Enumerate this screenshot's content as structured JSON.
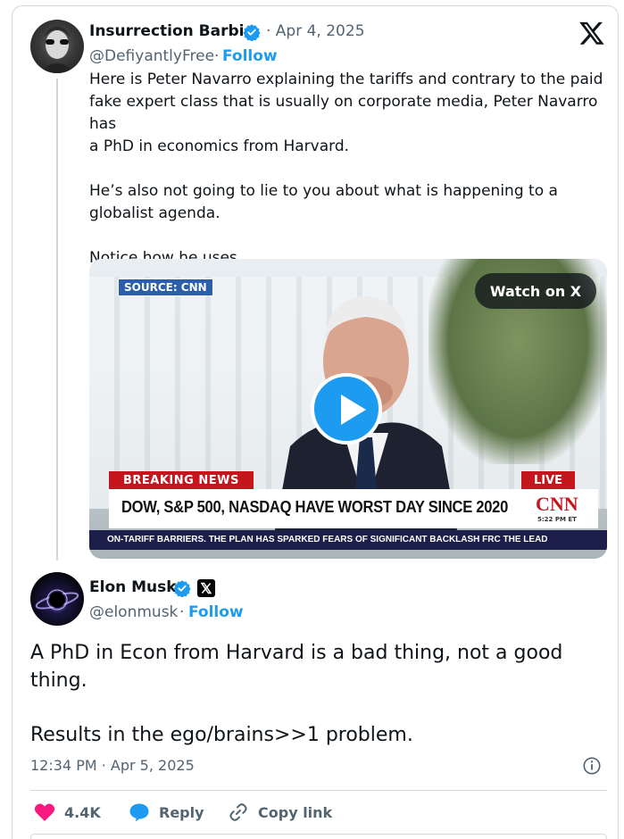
{
  "quoted": {
    "display_name": "Insurrection Barbie",
    "date": "· Apr 4, 2025",
    "handle": "@DefiyantlyFree",
    "separator": "·",
    "follow_label": "Follow",
    "text_lines": [
      "Here is Peter Navarro explaining the tariffs and contrary to the paid",
      "fake expert class that is usually on corporate media, Peter Navarro has",
      "a PhD in economics from Harvard.",
      "He’s also not going to lie to you about what is happening to a",
      "globalist agenda.",
      "Notice how he uses"
    ],
    "video": {
      "source_tag": "SOURCE: CNN",
      "watch_label": "Watch on X",
      "breaking_label": "BREAKING NEWS",
      "live_label": "LIVE",
      "headline": "DOW, S&P 500, NASDAQ HAVE WORST DAY SINCE 2020",
      "network_logo": "CNN",
      "network_time": "5:22 PM ET",
      "ticker": "ON-TARIFF BARRIERS. THE PLAN HAS SPARKED FEARS OF SIGNIFICANT BACKLASH FRC   THE LEAD"
    }
  },
  "main": {
    "display_name": "Elon Musk",
    "handle": "@elonmusk",
    "separator": "·",
    "follow_label": "Follow",
    "text_lines": [
      "A PhD in Econ from Harvard is a bad thing, not a good",
      "thing.",
      "Results in the ego/brains>>1 problem."
    ],
    "timestamp": "12:34 PM · Apr 5, 2025"
  },
  "actions": {
    "likes": "4.4K",
    "reply_label": "Reply",
    "copy_link_label": "Copy link"
  },
  "colors": {
    "accent": "#1d9bf0",
    "like": "#f91880",
    "muted": "#536471",
    "cnn_red": "#c4161c"
  },
  "icons": [
    "verified-badge-icon",
    "x-logo-icon",
    "play-icon",
    "info-icon",
    "heart-icon",
    "reply-bubble-icon",
    "link-icon"
  ]
}
